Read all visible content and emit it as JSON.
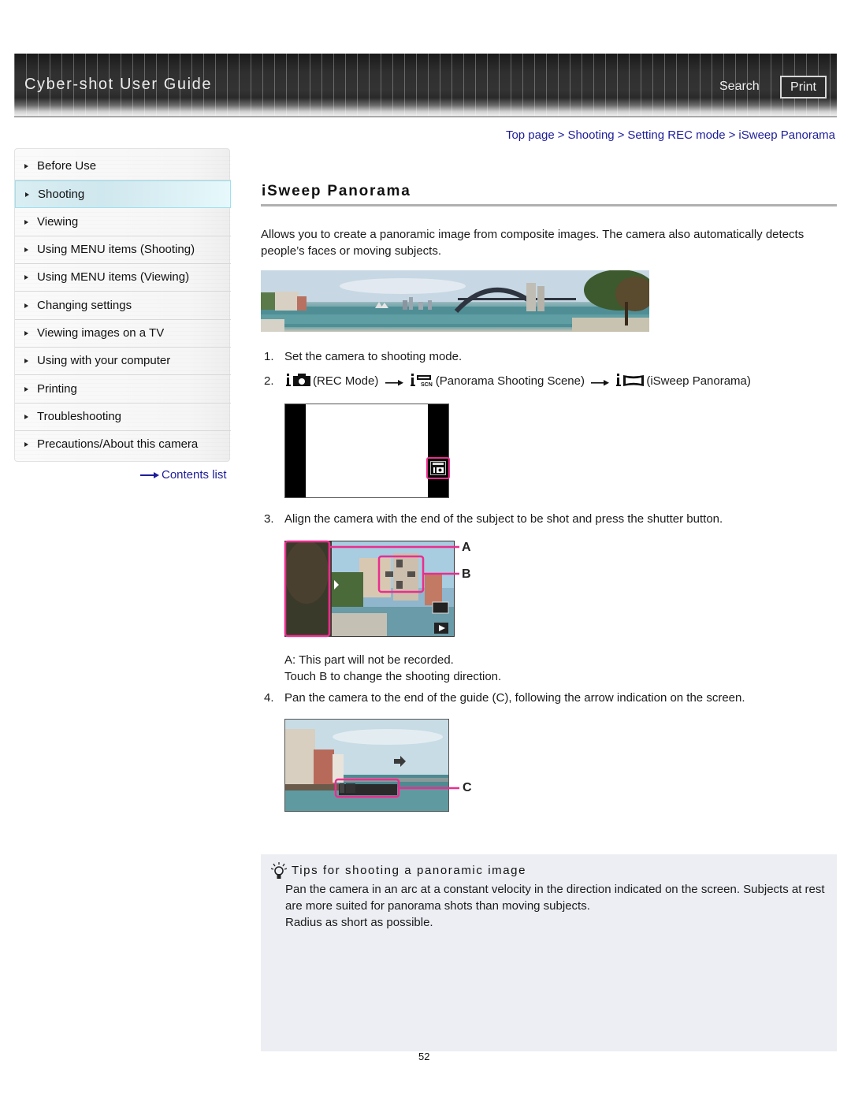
{
  "header": {
    "app_title": "Cyber-shot User Guide",
    "search_label": "Search",
    "print_label": "Print"
  },
  "breadcrumb": [
    {
      "label": "Top page"
    },
    {
      "label": "Shooting"
    },
    {
      "label": "Setting REC mode"
    },
    {
      "label": "iSweep Panorama"
    }
  ],
  "breadcrumb_separator": ">",
  "sidebar": {
    "items": [
      {
        "label": "Before Use",
        "active": false
      },
      {
        "label": "Shooting",
        "active": true
      },
      {
        "label": "Viewing",
        "active": false
      },
      {
        "label": "Using MENU items (Shooting)",
        "active": false
      },
      {
        "label": "Using MENU items (Viewing)",
        "active": false
      },
      {
        "label": "Changing settings",
        "active": false
      },
      {
        "label": "Viewing images on a TV",
        "active": false
      },
      {
        "label": "Using with your computer",
        "active": false
      },
      {
        "label": "Printing",
        "active": false
      },
      {
        "label": "Troubleshooting",
        "active": false
      },
      {
        "label": "Precautions/About this camera",
        "active": false
      }
    ],
    "contents_link": "Contents list"
  },
  "main": {
    "title": "iSweep Panorama",
    "intro": "Allows you to create a panoramic image from composite images. The camera also automatically detects people’s faces or moving subjects.",
    "steps": [
      {
        "num": "1.",
        "text": "Set the camera to shooting mode."
      },
      {
        "num": "2.",
        "parts": [
          {
            "icon": "rec-mode-icon",
            "text": "(REC Mode)"
          },
          {
            "icon": "panorama-scene-icon",
            "text": "(Panorama Shooting Scene)"
          },
          {
            "icon": "isweep-panorama-icon",
            "text": "(iSweep Panorama)"
          }
        ]
      },
      {
        "num": "3.",
        "text": "Align the camera with the end of the subject to be shot and press the shutter button."
      },
      {
        "num": "4.",
        "text": "Pan the camera to the end of the guide (C), following the arrow indication on the screen."
      }
    ],
    "step3_notes": [
      "A: This part will not be recorded.",
      "Touch B to change the shooting direction."
    ],
    "callouts": {
      "a": "A",
      "b": "B",
      "c": "C"
    },
    "tips": {
      "title": "Tips for shooting a panoramic image",
      "body": [
        "Pan the camera in an arc at a constant velocity in the direction indicated on the screen. Subjects at rest are more suited for panorama shots than moving subjects.",
        "Radius as short as possible."
      ]
    }
  },
  "page_number": "52",
  "colors": {
    "link": "#1d1d9a",
    "highlight": "#ea2e8d",
    "active_nav": "#d9eef2",
    "tips_bg": "#eceef3"
  }
}
